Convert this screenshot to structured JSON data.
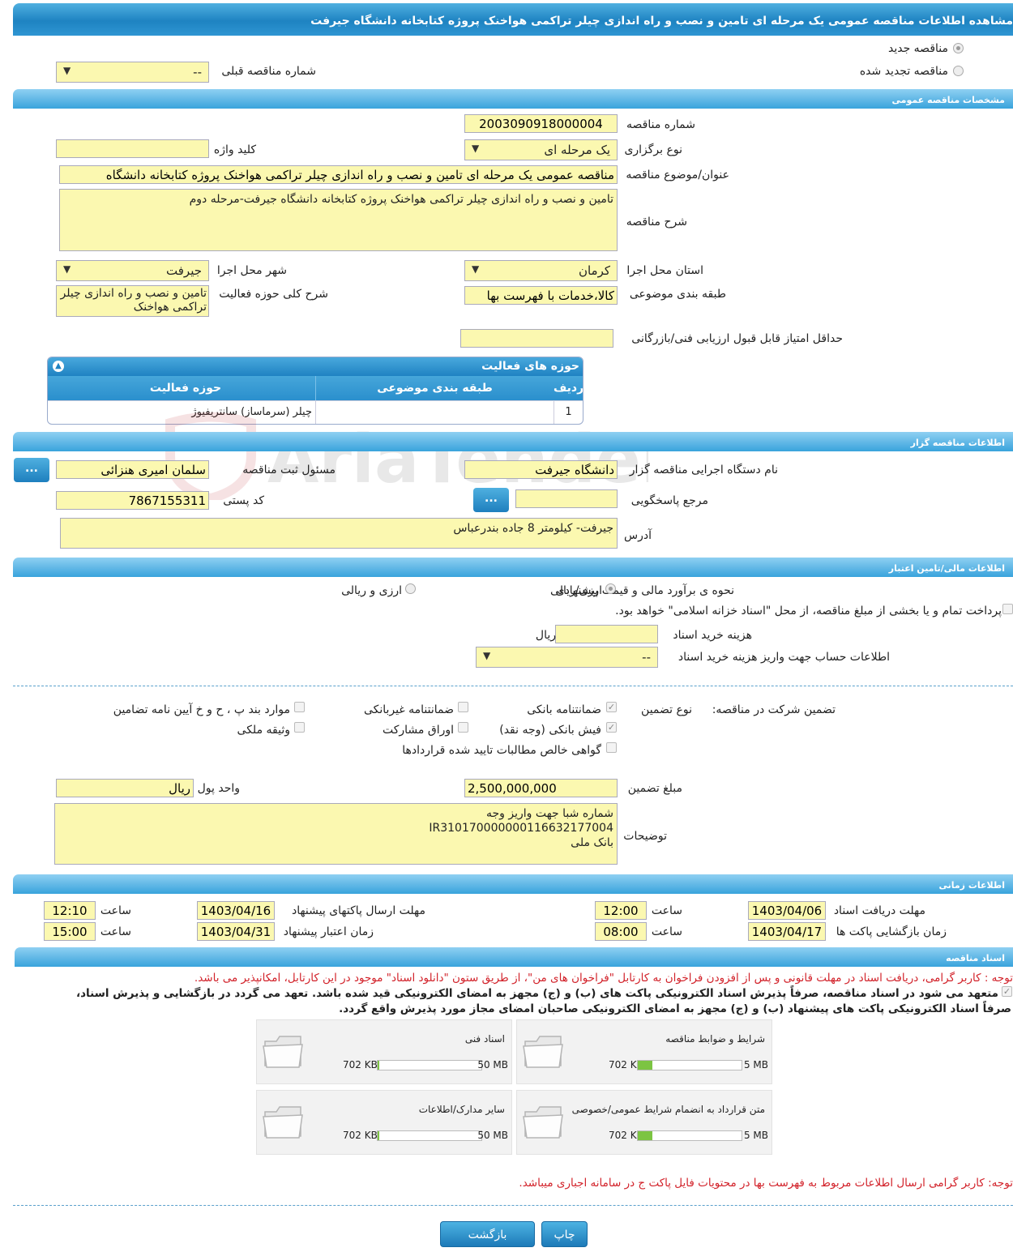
{
  "header": {
    "title": "مشاهده اطلاعات مناقصه عمومی یک مرحله ای تامین و نصب و راه اندازی چیلر تراکمی هواخنک پروژه کتابخانه دانشگاه جیرفت"
  },
  "top": {
    "radio_new": "مناقصه جدید",
    "radio_renewed": "مناقصه تجدید شده",
    "prev_label": "شماره مناقصه قبلی",
    "prev_value": "--"
  },
  "general": {
    "section": "مشخصات مناقصه عمومی",
    "number_label": "شماره مناقصه",
    "number_value": "2003090918000004",
    "type_label": "نوع برگزاری",
    "type_value": "یک مرحله ای",
    "keyword_label": "کلید واژه",
    "keyword_value": "",
    "title_label": "عنوان/موضوع مناقصه",
    "title_value": "مناقصه عمومی یک مرحله ای تامین و نصب و راه اندازی چیلر تراکمی هواخنک پروژه کتابخانه دانشگاه",
    "desc_label": "شرح مناقصه",
    "desc_value": "تامین و نصب و راه اندازی چیلر تراکمی هواخنک پروژه کتابخانه دانشگاه جیرفت-مرحله دوم",
    "province_label": "استان محل اجرا",
    "province_value": "کرمان",
    "city_label": "شهر محل اجرا",
    "city_value": "جیرفت",
    "category_label": "طبقه بندی موضوعی",
    "category_value": "کالا،خدمات با فهرست بها",
    "scope_label": "شرح کلی حوزه فعالیت",
    "scope_value": "تامین و نصب و راه اندازی چیلر تراکمی هواخنک",
    "minscore_label": "حداقل امتیاز قابل قبول ارزیابی فنی/بازرگانی",
    "minscore_value": ""
  },
  "activity_grid": {
    "title": "حوزه های فعالیت",
    "col_row": "ردیف",
    "col_category": "طبقه بندی موضوعی",
    "col_field": "حوزه فعالیت",
    "rows": [
      {
        "row": "1",
        "category": "",
        "field": "چیلر (سرماساز) سانتریفیوژ"
      }
    ]
  },
  "watermark": "AriaTender.neT",
  "organizer": {
    "section": "اطلاعات مناقصه گزار",
    "org_label": "نام دستگاه اجرایی مناقصه گزار",
    "org_value": "دانشگاه جیرفت",
    "resp_label": "مسئول ثبت مناقصه",
    "resp_value": "سلمان امیری هنزائی",
    "ref_label": "مرجع پاسخگویی",
    "ref_value": "",
    "postal_label": "کد پستی",
    "postal_value": "7867155311",
    "address_label": "آدرس",
    "address_value": "جیرفت- کیلومتر 8 جاده بندرعباس",
    "btn_dots": "..."
  },
  "finance": {
    "section": "اطلاعات مالی/تامین اعتبار",
    "estimate_label": "نحوه ی برآورد مالی و قیمت پیشنهادی",
    "opt_currency_rial": "ارزی/ریالی",
    "opt_currency_and_rial": "ارزی و ریالی",
    "treasury_text": "پرداخت تمام و یا بخشی از مبلغ مناقصه، از محل \"اسناد خزانه اسلامی\" خواهد بود.",
    "doc_cost_label": "هزینه خرید اسناد",
    "doc_cost_value": "",
    "doc_cost_unit": "ریال",
    "account_label": "اطلاعات حساب جهت واریز هزینه خرید اسناد",
    "account_value": "--"
  },
  "guarantee": {
    "main_label": "تضمین شرکت در مناقصه:",
    "type_label": "نوع تضمین",
    "bank_guarantee": "ضمانتنامه بانکی",
    "nonbank_guarantee": "ضمانتنامه غیربانکی",
    "items_bpjk": "موارد بند پ ، ح و خ آیین نامه تضامین",
    "bank_receipt": "فیش بانکی (وجه نقد)",
    "bonds": "اوراق مشارکت",
    "property": "وثیقه ملکی",
    "claims_cert": "گواهی خالص مطالبات تایید شده قراردادها",
    "amount_label": "مبلغ تضمین",
    "amount_value": "2,500,000,000",
    "currency_label": "واحد پول",
    "currency_value": "ریال",
    "notes_label": "توضیحات",
    "notes_value": "شماره شبا جهت واریز وجه\nIR310170000000116632177004\nبانک ملی"
  },
  "timing": {
    "section": "اطلاعات زمانی",
    "doc_deadline_label": "مهلت دریافت اسناد",
    "doc_deadline_date": "1403/04/06",
    "time_label": "ساعت",
    "doc_deadline_time": "12:00",
    "send_deadline_label": "مهلت ارسال پاکتهای پیشنهاد",
    "send_deadline_date": "1403/04/16",
    "send_deadline_time": "12:10",
    "opening_label": "زمان بازگشایی پاکت ها",
    "opening_date": "1403/04/17",
    "opening_time": "08:00",
    "validity_label": "زمان اعتبار پیشنهاد",
    "validity_date": "1403/04/31",
    "validity_time": "15:00"
  },
  "documents": {
    "section": "اسناد مناقصه",
    "note1": "توجه : کاربر گرامی، دریافت اسناد در مهلت قانونی و پس از افزودن فراخوان به کارتابل \"فراخوان های من\"، از طریق ستون \"دانلود اسناد\" موجود در این کارتابل، امکانپذیر می باشد.",
    "commit_line1": "متعهد می شود در اسناد مناقصه، صرفاً پذیرش اسناد الکترونیکی پاکت های (ب) و (ج) مجهز به امضای الکترونیکی قید شده باشد. تعهد می گردد در بازگشایی و پذیرش اسناد،",
    "commit_line2": "صرفاً اسناد الکترونیکی پاکت های پیشنهاد (ب) و (ج) مجهز به امضای الکترونیکی صاحبان امضای مجاز مورد پذیرش واقع گردد.",
    "files": [
      {
        "name": "شرایط و ضوابط مناقصه",
        "used": "702 KB",
        "max": "5 MB",
        "fill": 0.137
      },
      {
        "name": "اسناد فنی",
        "used": "702 KB",
        "max": "50 MB",
        "fill": 0.014
      },
      {
        "name": "متن قرارداد به انضمام شرایط عمومی/خصوصی",
        "used": "702 KB",
        "max": "5 MB",
        "fill": 0.137
      },
      {
        "name": "سایر مدارک/اطلاعات",
        "used": "702 KB",
        "max": "50 MB",
        "fill": 0.014
      }
    ],
    "note2": "توجه: کاربر گرامی ارسال اطلاعات مربوط به فهرست بها در محتویات فایل پاکت ج در سامانه اجباری میباشد."
  },
  "footer": {
    "print_label": "چاپ",
    "back_label": "بازگشت"
  },
  "colors": {
    "header_blue": "#1e83c2",
    "field_yellow": "#fbf8b0",
    "note_red": "#d2222a",
    "progress_green": "#7cc442"
  }
}
